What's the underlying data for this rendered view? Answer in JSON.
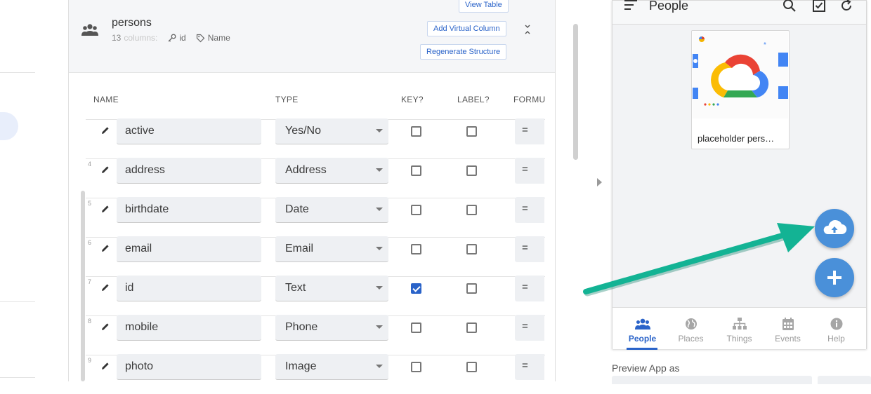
{
  "table": {
    "name": "persons",
    "columns_count": "13",
    "columns_word": "columns:",
    "key_column": "id",
    "label_column": "Name",
    "view_table_label": "View Table",
    "add_virtual_column_label": "Add Virtual Column",
    "regenerate_label": "Regenerate Structure"
  },
  "column_headers": {
    "name": "NAME",
    "type": "TYPE",
    "key": "KEY?",
    "label": "LABEL?",
    "formula": "FORMU"
  },
  "rows": [
    {
      "num": "",
      "name": "active",
      "type": "Yes/No",
      "key": false,
      "label": false,
      "formula": "="
    },
    {
      "num": "4",
      "name": "address",
      "type": "Address",
      "key": false,
      "label": false,
      "formula": "="
    },
    {
      "num": "5",
      "name": "birthdate",
      "type": "Date",
      "key": false,
      "label": false,
      "formula": "="
    },
    {
      "num": "6",
      "name": "email",
      "type": "Email",
      "key": false,
      "label": false,
      "formula": "="
    },
    {
      "num": "7",
      "name": "id",
      "type": "Text",
      "key": true,
      "label": false,
      "formula": "="
    },
    {
      "num": "8",
      "name": "mobile",
      "type": "Phone",
      "key": false,
      "label": false,
      "formula": "="
    },
    {
      "num": "9",
      "name": "photo",
      "type": "Image",
      "key": false,
      "label": false,
      "formula": "="
    }
  ],
  "phone": {
    "title": "People",
    "card_label": "placeholder pers…",
    "nav": [
      {
        "label": "People",
        "icon": "people-icon",
        "active": true
      },
      {
        "label": "Places",
        "icon": "globe-icon",
        "active": false
      },
      {
        "label": "Things",
        "icon": "hierarchy-icon",
        "active": false
      },
      {
        "label": "Events",
        "icon": "calendar-icon",
        "active": false
      },
      {
        "label": "Help",
        "icon": "info-icon",
        "active": false
      }
    ]
  },
  "preview_label": "Preview App as",
  "colors": {
    "accent": "#2a63c9",
    "fab": "#4a90d9",
    "annotation_arrow": "#13b394"
  }
}
